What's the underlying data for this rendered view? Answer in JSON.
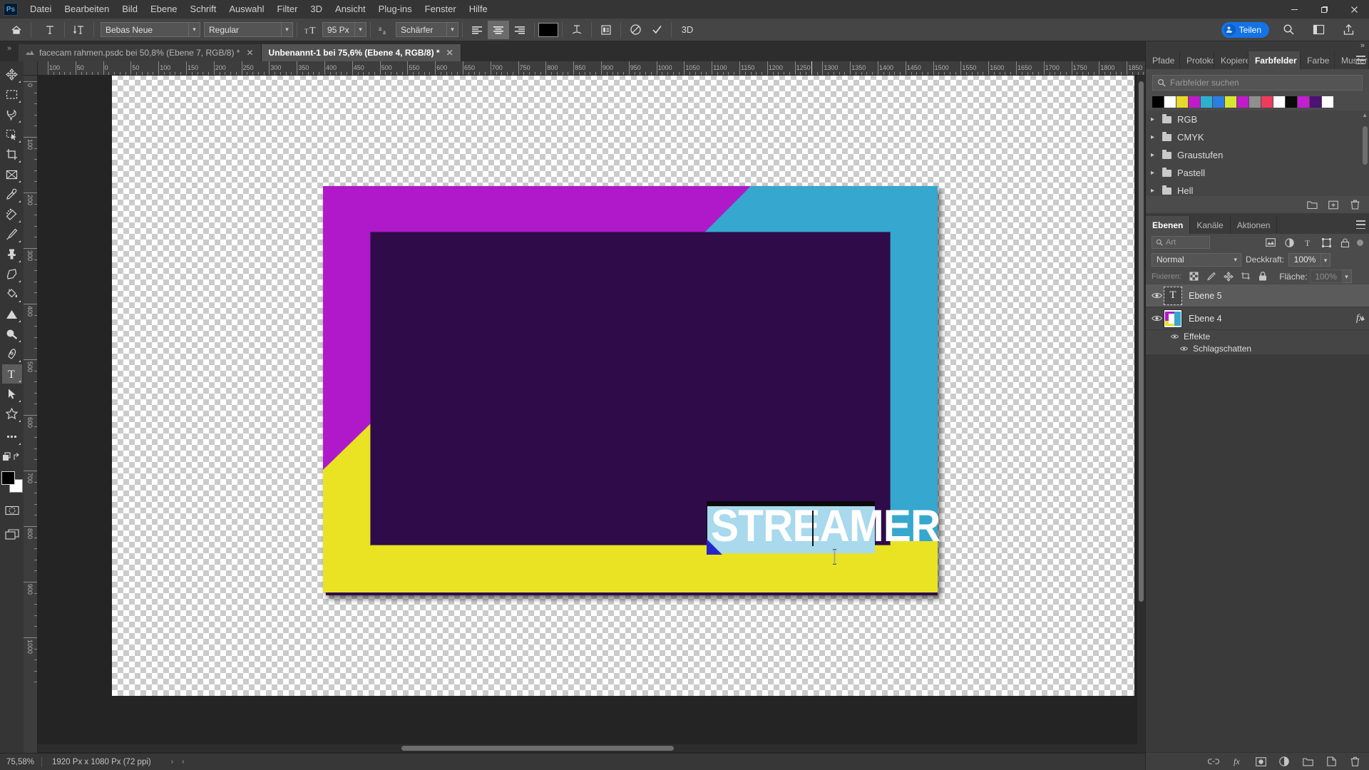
{
  "app": {
    "name": "Ps",
    "logo_label": "Ps"
  },
  "menubar": {
    "items": [
      {
        "label": "Datei"
      },
      {
        "label": "Bearbeiten"
      },
      {
        "label": "Bild"
      },
      {
        "label": "Ebene"
      },
      {
        "label": "Schrift"
      },
      {
        "label": "Auswahl"
      },
      {
        "label": "Filter"
      },
      {
        "label": "3D"
      },
      {
        "label": "Ansicht"
      },
      {
        "label": "Plug-ins"
      },
      {
        "label": "Fenster"
      },
      {
        "label": "Hilfe"
      }
    ]
  },
  "window_controls": {
    "minimize": "—",
    "maximize": "❐",
    "close": "✕"
  },
  "options_bar": {
    "home_icon": "home-icon",
    "tool_icon": "type-tool-icon",
    "orientation_icon": "text-orientation-icon",
    "font_family": "Bebas Neue",
    "font_style": "Regular",
    "size_icon": "font-size-icon",
    "font_size": "95 Px",
    "aa_icon": "anti-alias-icon",
    "anti_alias": "Schärfer",
    "align_left": "align-left-icon",
    "align_center": "align-center-icon",
    "align_right": "align-right-icon",
    "text_color": "#000000",
    "warp_icon": "warp-text-icon",
    "panel_icon": "character-panel-icon",
    "cancel_icon": "cancel-icon",
    "commit_icon": "commit-icon",
    "three_d_label": "3D",
    "share_label": "Teilen",
    "search_icon": "search-icon",
    "workspace_icon": "workspace-icon",
    "export_icon": "share-export-icon"
  },
  "tabs": {
    "overflow_label": "»",
    "items": [
      {
        "title": "facecam rahmen.psdc bei 50,8% (Ebene 7, RGB/8) *",
        "active": false,
        "close": "✕"
      },
      {
        "title": "Unbenannt-1 bei 75,6% (Ebene 4, RGB/8) *",
        "active": true,
        "close": "✕"
      }
    ]
  },
  "toolbar": {
    "tools": [
      {
        "name": "move-tool",
        "icon": "move"
      },
      {
        "name": "marquee-tool",
        "icon": "marquee"
      },
      {
        "name": "lasso-tool",
        "icon": "lasso"
      },
      {
        "name": "quick-selection-tool",
        "icon": "quickselect"
      },
      {
        "name": "crop-tool",
        "icon": "crop"
      },
      {
        "name": "frame-tool",
        "icon": "frame"
      },
      {
        "name": "eyedropper-tool",
        "icon": "eyedropper"
      },
      {
        "name": "healing-brush-tool",
        "icon": "healing"
      },
      {
        "name": "brush-tool",
        "icon": "brush"
      },
      {
        "name": "clone-stamp-tool",
        "icon": "stamp"
      },
      {
        "name": "eraser-tool",
        "icon": "eraser"
      },
      {
        "name": "paint-bucket-tool",
        "icon": "bucket"
      },
      {
        "name": "gradient-tool",
        "icon": "gradient"
      },
      {
        "name": "dodge-tool",
        "icon": "dodge"
      },
      {
        "name": "pen-tool",
        "icon": "pen"
      },
      {
        "name": "type-tool",
        "icon": "type",
        "active": true
      },
      {
        "name": "path-selection-tool",
        "icon": "pathselect"
      },
      {
        "name": "shape-tool",
        "icon": "shape"
      },
      {
        "name": "more-tools",
        "icon": "ellipsis"
      },
      {
        "name": "edit-toolbar",
        "icon": "editbar"
      }
    ],
    "foreground_color": "#000000",
    "background_color": "#ffffff",
    "quickmask_name": "quick-mask-icon",
    "screenmode_name": "screen-mode-icon"
  },
  "rulers": {
    "unit": "px",
    "h_ticks": [
      "100",
      "50",
      "0",
      "50",
      "100",
      "150",
      "200",
      "250",
      "300",
      "350",
      "400",
      "450",
      "500",
      "550",
      "600",
      "650",
      "700",
      "750",
      "800",
      "850",
      "900",
      "950",
      "1000",
      "1050",
      "1100",
      "1150",
      "1200",
      "1250",
      "1300",
      "1350",
      "1400",
      "1450",
      "1500",
      "1550",
      "1600",
      "1650",
      "1700",
      "1750",
      "1800",
      "1850"
    ],
    "v_ticks": [
      "0",
      "100",
      "200",
      "300",
      "400",
      "500",
      "600",
      "700",
      "800",
      "900",
      "1000"
    ]
  },
  "canvas": {
    "artwork_name": "facecam-frame-artwork",
    "frame_colors": {
      "magenta": "#b019c9",
      "cyan": "#36a7ce",
      "yellow": "#e9e324",
      "dark_purple": "#2f0b4a",
      "blue_accent": "#2626c8"
    },
    "text_layer": {
      "content": "STREAMER",
      "color": "#ffffff",
      "selection_color": "#a8d9ec",
      "shadow_color": "#0b0b0b"
    },
    "cursor": "text-ibeam-cursor"
  },
  "swatches_panel": {
    "tabs": [
      {
        "label": "Pfade",
        "active": false
      },
      {
        "label": "Protokoll",
        "active": false
      },
      {
        "label": "Kopieren",
        "active": false
      },
      {
        "label": "Farbfelder",
        "active": true
      },
      {
        "label": "Farbe",
        "active": false
      },
      {
        "label": "Muster",
        "active": false
      }
    ],
    "menu_icon": "panel-menu-icon",
    "search_icon": "search-icon",
    "search_placeholder": "Farbfelder suchen",
    "search_value": "",
    "recent_swatches": [
      "#000000",
      "#ffffff",
      "#e8d92a",
      "#c01bc9",
      "#2fafce",
      "#2b7fe0",
      "#d9e62e",
      "#c01bc9",
      "#8f8f8f",
      "#ef3b5c",
      "#ffffff",
      "#0a0a0a",
      "#c11fd0",
      "#4b1273",
      "#ffffff"
    ],
    "groups": [
      {
        "label": "RGB",
        "expanded": false
      },
      {
        "label": "CMYK",
        "expanded": false
      },
      {
        "label": "Graustufen",
        "expanded": false
      },
      {
        "label": "Pastell",
        "expanded": false
      },
      {
        "label": "Hell",
        "expanded": false
      }
    ],
    "footer_icons": [
      {
        "name": "new-group-icon"
      },
      {
        "name": "new-swatch-icon"
      },
      {
        "name": "delete-swatch-icon"
      }
    ]
  },
  "layers_panel": {
    "tabs": [
      {
        "label": "Ebenen",
        "active": true
      },
      {
        "label": "Kanäle",
        "active": false
      },
      {
        "label": "Aktionen",
        "active": false
      }
    ],
    "menu_icon": "panel-menu-icon",
    "filter_placeholder": "Art",
    "filter_value": "",
    "filter_icons": [
      {
        "name": "filter-pixel-icon"
      },
      {
        "name": "filter-adjustment-icon"
      },
      {
        "name": "filter-type-icon"
      },
      {
        "name": "filter-shape-icon"
      },
      {
        "name": "filter-smart-object-icon"
      }
    ],
    "filter_toggle": "filter-enable-toggle",
    "blend_mode": "Normal",
    "opacity_label": "Deckkraft:",
    "opacity_value": "100%",
    "lock_label": "Fixieren:",
    "lock_icons": [
      {
        "name": "lock-transparency-icon"
      },
      {
        "name": "lock-image-icon"
      },
      {
        "name": "lock-position-icon"
      },
      {
        "name": "lock-artboard-icon"
      },
      {
        "name": "lock-all-icon"
      }
    ],
    "fill_label": "Fläche:",
    "fill_value": "100%",
    "layers": [
      {
        "name": "Ebene 5",
        "type": "text",
        "thumb_glyph": "T",
        "selected": true,
        "visible": true,
        "has_fx": false,
        "effects": []
      },
      {
        "name": "Ebene 4",
        "type": "image",
        "selected": false,
        "visible": true,
        "has_fx": true,
        "fx_label": "fx",
        "effects": [
          {
            "label": "Effekte",
            "visible": true
          },
          {
            "label": "Schlagschatten",
            "visible": true
          }
        ]
      }
    ],
    "footer_icons": [
      {
        "name": "link-layers-icon"
      },
      {
        "name": "layer-style-icon"
      },
      {
        "name": "layer-mask-icon"
      },
      {
        "name": "adjustment-layer-icon"
      },
      {
        "name": "new-group-icon"
      },
      {
        "name": "new-layer-icon"
      },
      {
        "name": "delete-layer-icon"
      }
    ]
  },
  "statusbar": {
    "zoom": "75,58%",
    "doc_size": "1920 Px x 1080 Px (72 ppi)",
    "next_arrow": "›",
    "prev_arrow": "‹"
  }
}
